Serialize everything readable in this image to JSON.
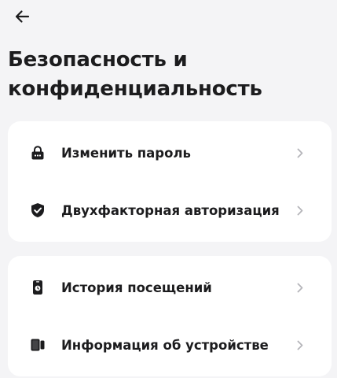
{
  "header": {
    "back_icon": "arrow-left-icon",
    "title": "Безопасность и конфиденциальность"
  },
  "sections": [
    {
      "items": [
        {
          "label": "Изменить пароль",
          "icon": "lock-icon"
        },
        {
          "label": "Двухфакторная авторизация",
          "icon": "shield-check-icon"
        }
      ]
    },
    {
      "items": [
        {
          "label": "История посещений",
          "icon": "phone-history-icon"
        },
        {
          "label": "Информация об устройстве",
          "icon": "devices-icon"
        }
      ]
    }
  ],
  "colors": {
    "background": "#f4f4f6",
    "card": "#ffffff",
    "text": "#1c1c1e",
    "chevron": "#b5b5ba"
  }
}
